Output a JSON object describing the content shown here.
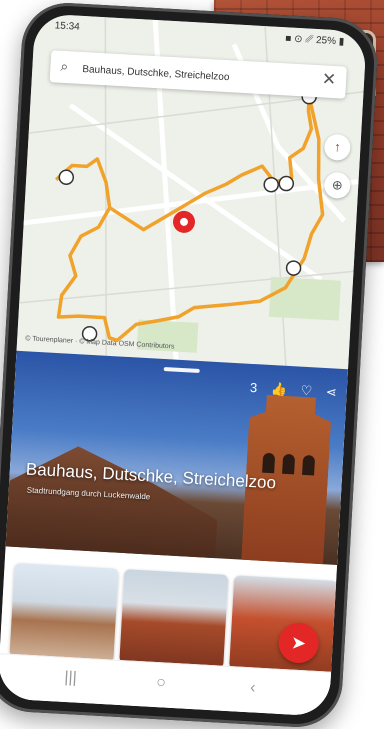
{
  "status": {
    "time": "15:34",
    "icons": "■ ⊙ ␥ 25% ▮"
  },
  "search": {
    "icon": "search-icon",
    "query": "Bauhaus, Dutschke, Streichelzoo",
    "close": "✕"
  },
  "map": {
    "attribution": "© Tourenplaner · © Map Data OSM Contributors",
    "route_color": "#f0a22a",
    "compass_glyph": "↑",
    "locate_glyph": "⊕"
  },
  "detail": {
    "title": "Bauhaus, Dutschke, Streichelzoo",
    "subtitle": "Stadtrundgang durch Luckenwalde",
    "like_count": "3",
    "like_glyph": "👍",
    "favorite_glyph": "♡",
    "share_glyph": "⋖"
  },
  "fab": {
    "glyph": "➤",
    "color": "#e32727"
  },
  "navbar": {
    "recent": "|||",
    "home": "○",
    "back": "‹"
  }
}
